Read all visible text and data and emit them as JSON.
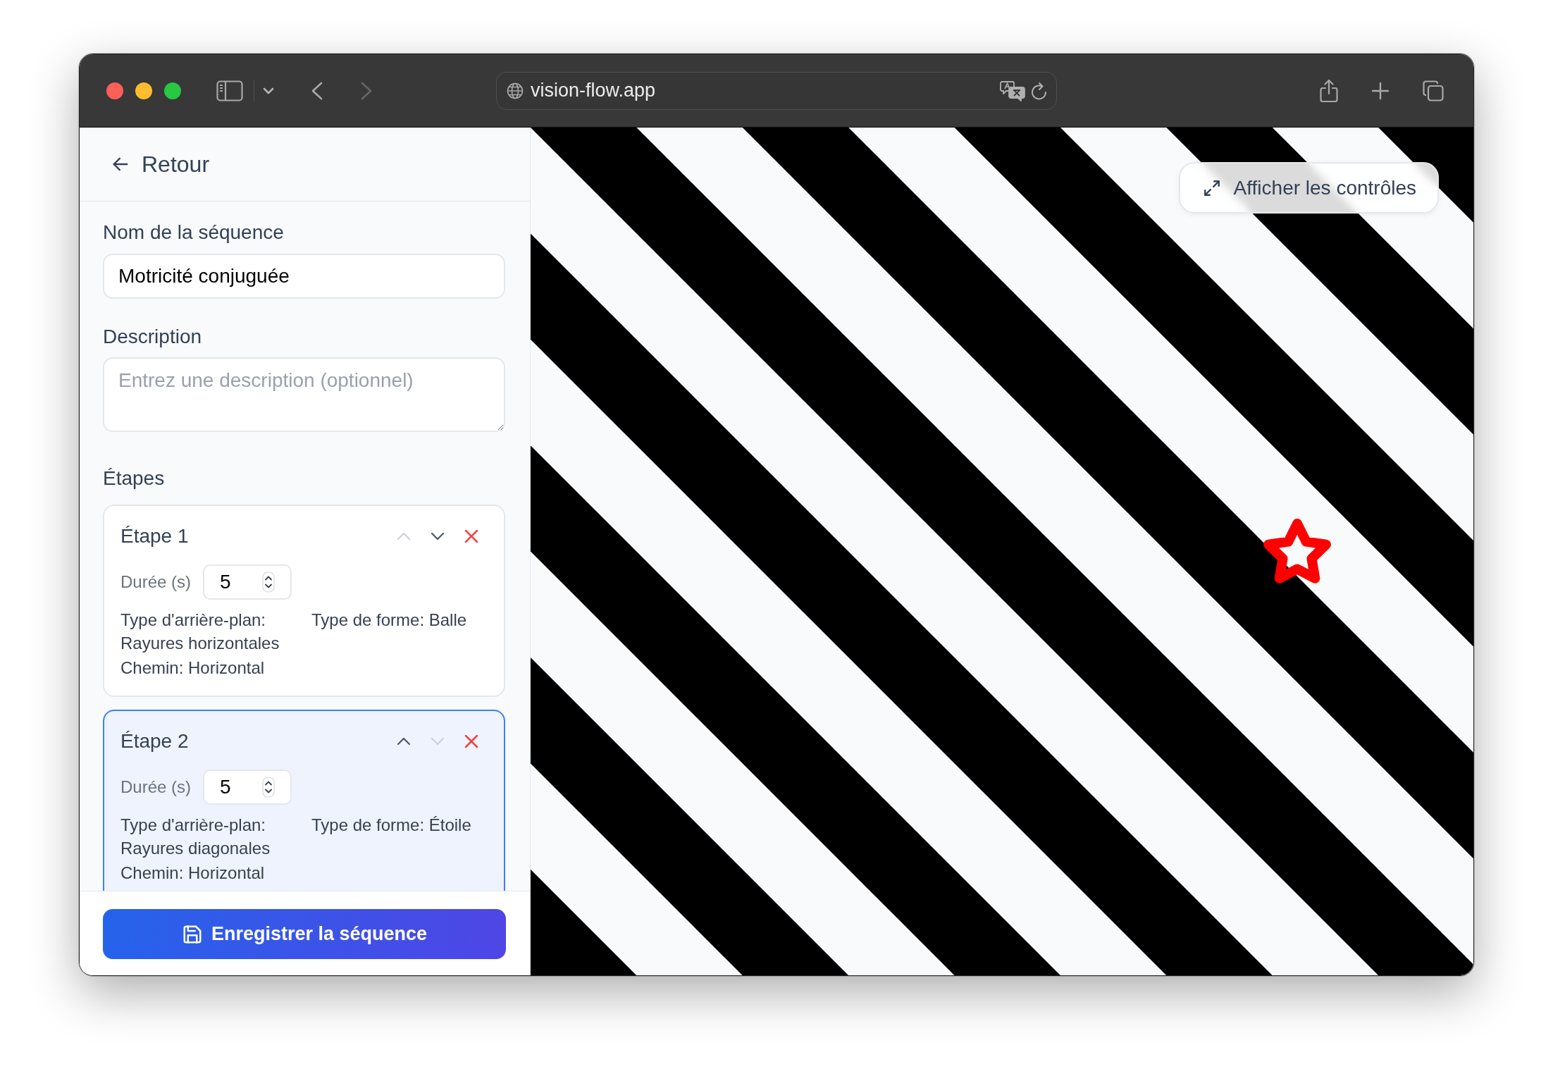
{
  "browser": {
    "url": "vision-flow.app",
    "back_disabled": false,
    "forward_disabled": true
  },
  "sidebar": {
    "back_link": "Retour",
    "name_field": {
      "label": "Nom de la séquence",
      "value": "Motricité conjuguée"
    },
    "description_field": {
      "label": "Description",
      "placeholder": "Entrez une description (optionnel)"
    },
    "steps_heading": "Étapes",
    "steps": [
      {
        "title": "Étape 1",
        "selected": false,
        "up_disabled": true,
        "down_disabled": false,
        "duration_label": "Durée (s)",
        "duration": "5",
        "background": "Type d'arrière-plan: Rayures horizontales",
        "shape": "Type de forme: Balle",
        "path": "Chemin: Horizontal"
      },
      {
        "title": "Étape 2",
        "selected": true,
        "up_disabled": false,
        "down_disabled": true,
        "duration_label": "Durée (s)",
        "duration": "5",
        "background": "Type d'arrière-plan: Rayures diagonales",
        "shape": "Type de forme: Étoile",
        "path": "Chemin: Horizontal"
      }
    ],
    "save_button": "Enregistrer la séquence"
  },
  "preview": {
    "controls_button": "Afficher les contrôles",
    "pattern": {
      "kind": "diagonal"
    },
    "shape": {
      "kind": "star"
    }
  }
}
